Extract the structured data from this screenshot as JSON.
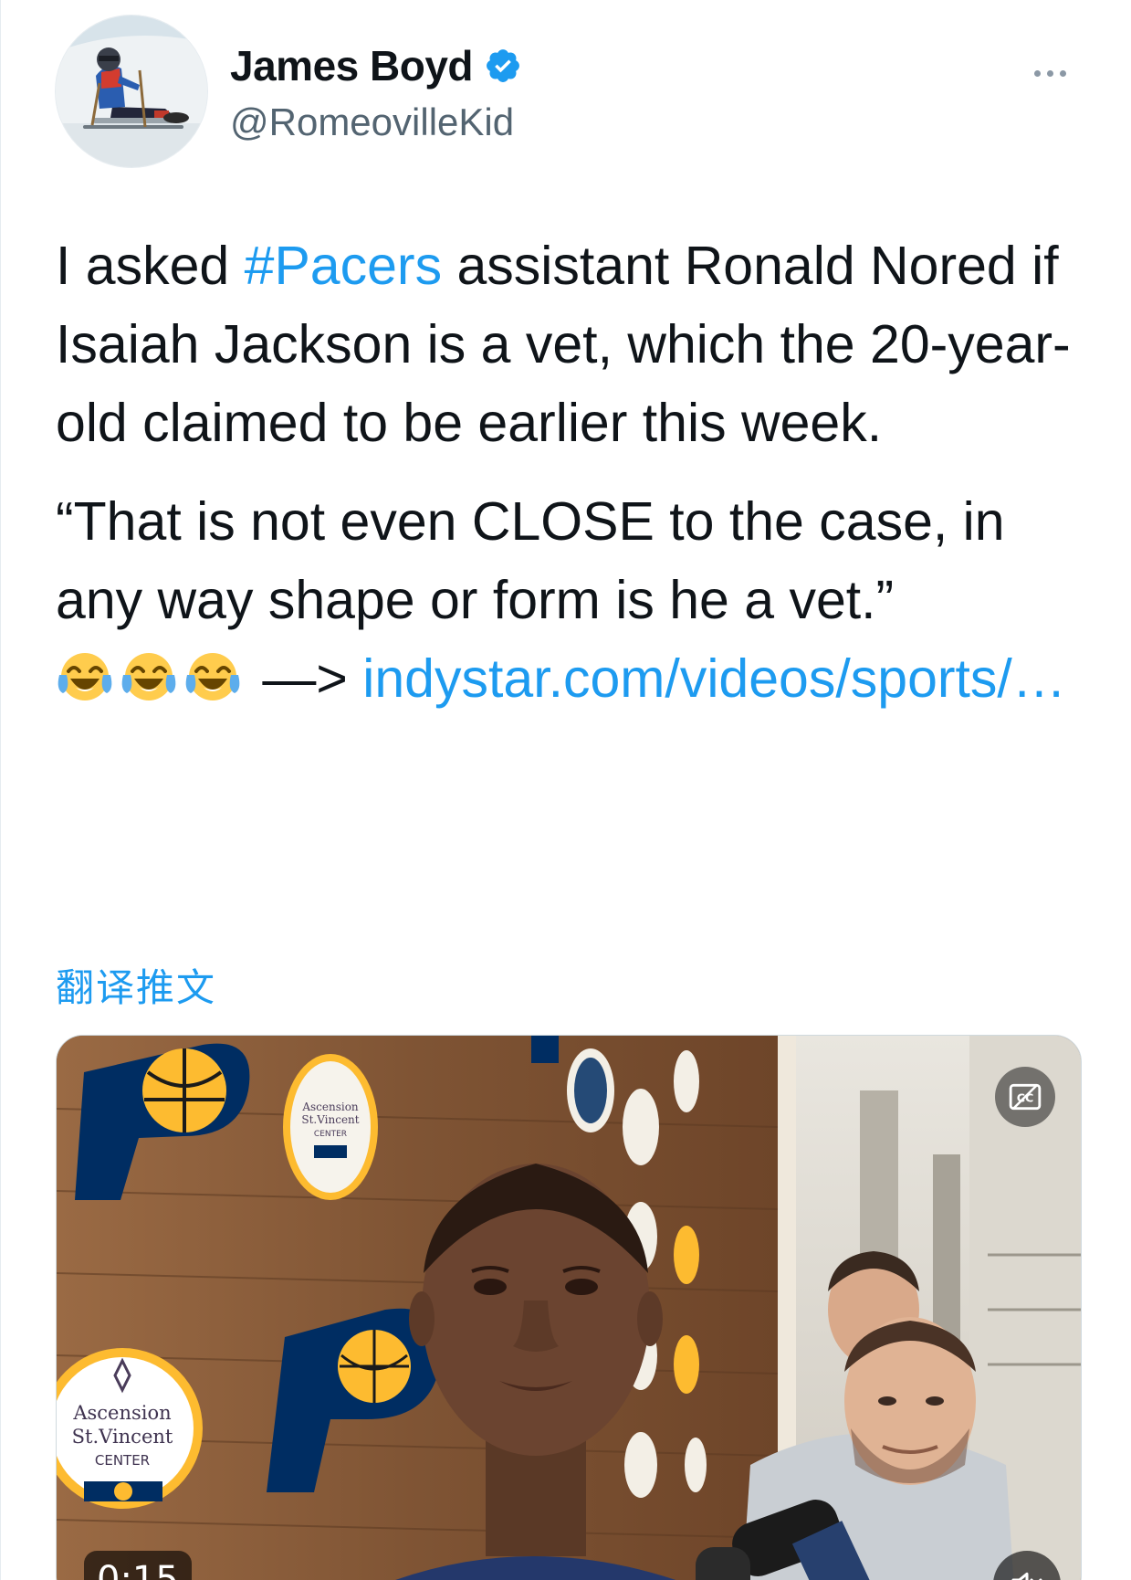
{
  "author": {
    "display_name": "James Boyd",
    "handle": "@RomeovilleKid",
    "verified": true,
    "avatar_icon": "profile-photo-sled-hockey"
  },
  "header": {
    "more_icon": "more-horizontal-icon"
  },
  "tweet": {
    "line1_pre": "I asked ",
    "hashtag": "#Pacers",
    "line1_post": " assistant Ronald Nored if Isaiah Jackson is a vet, which the 20-year-old claimed to be earlier this week.",
    "quote": "“That is not even CLOSE to the case, in any way shape or form is he a vet.”",
    "emojis": [
      "face-with-tears-of-joy",
      "face-with-tears-of-joy",
      "face-with-tears-of-joy"
    ],
    "arrow": " —> ",
    "link_text": "indystar.com/videos/sports/…"
  },
  "translate_label": "翻译推文",
  "media": {
    "type": "video",
    "duration": "0:15",
    "cc_icon": "closed-captions-icon",
    "mute_icon": "speaker-muted-icon",
    "sign_text": {
      "line1": "Ascension",
      "line2": "St.Vincent",
      "line3": "CENTER"
    }
  },
  "colors": {
    "link": "#1d9bf0",
    "text": "#0f1419",
    "secondary": "#536471",
    "pacers_navy": "#002d62",
    "pacers_gold": "#fdbb30"
  }
}
